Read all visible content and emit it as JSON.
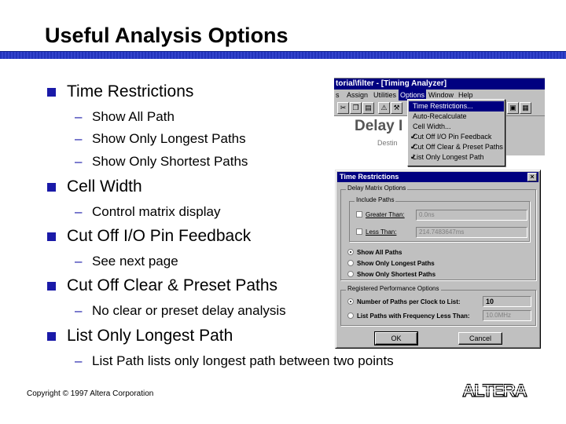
{
  "slide": {
    "title": "Useful Analysis Options",
    "copyright": "Copyright © 1997 Altera Corporation",
    "logo_text": "ALTERA"
  },
  "bullets": [
    {
      "text": "Time Restrictions",
      "subs": [
        "Show All Path",
        "Show Only Longest Paths",
        "Show Only Shortest Paths"
      ]
    },
    {
      "text": "Cell Width",
      "subs": [
        "Control matrix display"
      ]
    },
    {
      "text": "Cut Off I/O Pin Feedback",
      "subs": [
        "See next page"
      ]
    },
    {
      "text": "Cut Off Clear & Preset Paths",
      "subs": [
        "No clear or preset delay analysis"
      ]
    },
    {
      "text": "List Only Longest Path",
      "subs": [
        "List Path lists only longest path between two points"
      ]
    }
  ],
  "timing_window": {
    "title": "torial\\filter - [Timing Analyzer]",
    "menu": [
      "s",
      "Assign",
      "Utilities",
      "Options",
      "Window",
      "Help"
    ],
    "active_menu": "Options",
    "body_title": "Delay I",
    "body_sub": "Destin"
  },
  "options_menu": {
    "items": [
      {
        "label": "Time Restrictions...",
        "selected": true,
        "checked": false
      },
      {
        "label": "Auto-Recalculate",
        "selected": false,
        "checked": false
      },
      {
        "label": "Cell Width...",
        "selected": false,
        "checked": false
      },
      {
        "label": "Cut Off I/O Pin Feedback",
        "selected": false,
        "checked": true
      },
      {
        "label": "Cut Off Clear & Preset Paths",
        "selected": false,
        "checked": true
      },
      {
        "label": "List Only Longest Path",
        "selected": false,
        "checked": true
      }
    ]
  },
  "dialog": {
    "title": "Time Restrictions",
    "close_glyph": "×",
    "delay_group": "Delay Matrix Options",
    "include_group": "Include Paths",
    "greater_than_label": "Greater Than:",
    "greater_than_value": "0.0ns",
    "less_than_label": "Less Than:",
    "less_than_value": "214.7483647ms",
    "radio_all": "Show All Paths",
    "radio_longest": "Show Only Longest Paths",
    "radio_shortest": "Show Only Shortest Paths",
    "registered_group": "Registered Performance Options",
    "num_paths_label": "Number of Paths per Clock to List:",
    "num_paths_value": "10",
    "list_freq_label": "List Paths with Frequency Less Than:",
    "list_freq_value": "10.0MHz",
    "ok_label": "OK",
    "cancel_label": "Cancel"
  },
  "colors": {
    "accent": "#1a1aa8",
    "title_bar": "#000080",
    "window_face": "#c0c0c0"
  }
}
